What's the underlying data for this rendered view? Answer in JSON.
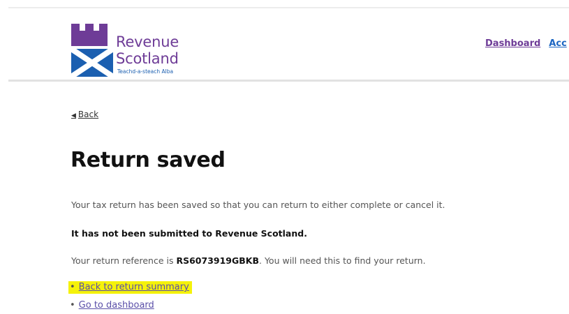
{
  "brand": {
    "name_line1": "Revenue",
    "name_line2": "Scotland",
    "tagline": "Teachd-a-steach Alba",
    "purple": "#6e3c97",
    "blue": "#1d66c2"
  },
  "nav": {
    "dashboard": "Dashboard",
    "account_partial": "Acc"
  },
  "back": {
    "label": "Back"
  },
  "main": {
    "title": "Return saved",
    "saved_text": "Your tax return has been saved so that you can return to either complete or cancel it.",
    "not_submitted_text": "It has not been submitted to Revenue Scotland.",
    "reference_prefix": "Your return reference is ",
    "reference_number": "RS6073919GBKB",
    "reference_suffix": ". You will need this to find your return."
  },
  "links": [
    {
      "label": "Back to return summary",
      "highlighted": true
    },
    {
      "label": "Go to dashboard",
      "highlighted": false
    }
  ],
  "highlight_color": "#f5f20a"
}
